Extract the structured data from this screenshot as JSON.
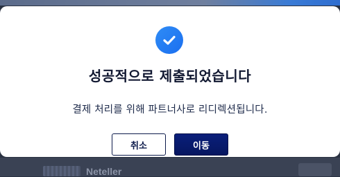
{
  "modal": {
    "title": "성공적으로 제출되었습니다",
    "message": "결제 처리를 위해 파트너사로 리디렉션됩니다.",
    "icon": "check-circle-icon",
    "icon_color": "#1f78f2"
  },
  "buttons": {
    "cancel_label": "취소",
    "go_label": "이동",
    "primary_color": "#061660"
  },
  "background": {
    "partner_name": "Neteller"
  }
}
